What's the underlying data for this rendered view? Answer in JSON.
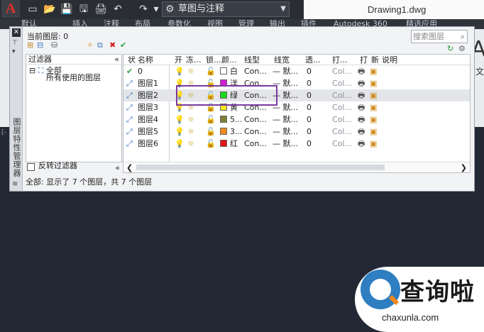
{
  "titlebar": {
    "logo": "A",
    "quick_access": [
      "▭",
      "📂",
      "💾",
      "🖫",
      "🖨",
      "↶",
      "↷",
      "▾"
    ],
    "workspace": "草图与注释",
    "document_title": "Drawing1.dwg"
  },
  "ribbon": {
    "tabs": [
      "默认",
      "插入",
      "注释",
      "布局",
      "参数化",
      "视图",
      "管理",
      "输出",
      "插件",
      "Autodesk 360",
      "精选应用"
    ],
    "right_glyph": "A",
    "right_label": "文"
  },
  "canvas": {
    "coord_hint": "[-"
  },
  "palette": {
    "vertical_title": "图层特性管理器",
    "current_layer_label": "当前图层: 0",
    "search_placeholder": "搜索图层",
    "filter_header": "过滤器",
    "tree_root": "全部",
    "tree_child": "所有使用的图层",
    "invert_filter": "反转过滤器",
    "status": "全部: 显示了 7 个图层，共 7 个图层"
  },
  "table": {
    "headers": [
      "状",
      "名称",
      "开",
      "冻...",
      "锁...",
      "颜...",
      "线型",
      "线宽",
      "透...",
      "打...",
      "打",
      "新",
      "说明"
    ],
    "rows": [
      {
        "status": "✔",
        "name": "0",
        "color_name": "白",
        "swatch": "#ffffff",
        "linetype": "Con...",
        "lineweight": "— 默...",
        "trans": "0",
        "plot_style": "Col..."
      },
      {
        "status": "⤢",
        "name": "图层1",
        "color_name": "洋",
        "swatch": "#d41cd4",
        "linetype": "Con...",
        "lineweight": "— 默...",
        "trans": "0",
        "plot_style": "Col..."
      },
      {
        "status": "⤢",
        "name": "图层2",
        "color_name": "绿",
        "swatch": "#19d919",
        "linetype": "Con...",
        "lineweight": "— 默...",
        "trans": "0",
        "plot_style": "Col..."
      },
      {
        "status": "⤢",
        "name": "图层3",
        "color_name": "黄",
        "swatch": "#f5e61e",
        "linetype": "Con...",
        "lineweight": "— 默...",
        "trans": "0",
        "plot_style": "Col..."
      },
      {
        "status": "⤢",
        "name": "图层4",
        "color_name": "5...",
        "swatch": "#808034",
        "linetype": "Con...",
        "lineweight": "— 默...",
        "trans": "0",
        "plot_style": "Col..."
      },
      {
        "status": "⤢",
        "name": "图层5",
        "color_name": "3...",
        "swatch": "#f08a20",
        "linetype": "Con...",
        "lineweight": "— 默...",
        "trans": "0",
        "plot_style": "Col..."
      },
      {
        "status": "⤢",
        "name": "图层6",
        "color_name": "红",
        "swatch": "#e21515",
        "linetype": "Con...",
        "lineweight": "— 默...",
        "trans": "0",
        "plot_style": "Col..."
      }
    ],
    "selected_row": 2
  },
  "icons": {
    "on": "💡",
    "freeze": "☼",
    "lock": "🔓",
    "plot": "🖶",
    "new_vp": "▣"
  },
  "watermark": {
    "brand": "查询啦",
    "url": "chaxunla.com"
  },
  "colors": {
    "highlight": "#7a3a9e",
    "canvas": "#232934",
    "brand_blue": "#2f7ec1",
    "brand_orange": "#f28a1a"
  }
}
